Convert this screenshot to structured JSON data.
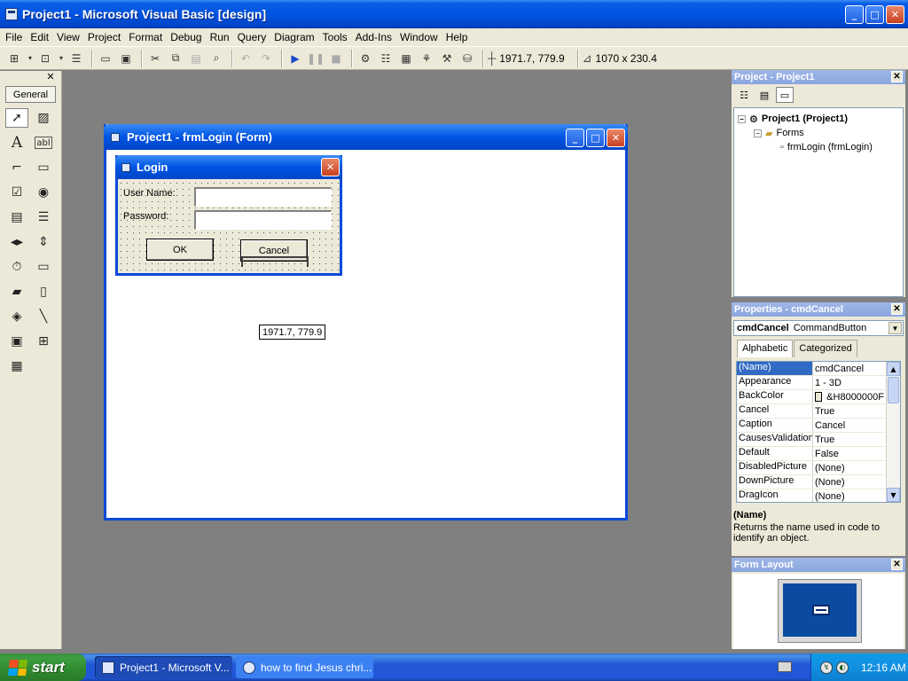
{
  "window": {
    "title": "Project1 - Microsoft Visual Basic [design]",
    "min": "_",
    "max": "□",
    "close": "✕"
  },
  "menu": [
    "File",
    "Edit",
    "View",
    "Project",
    "Format",
    "Debug",
    "Run",
    "Query",
    "Diagram",
    "Tools",
    "Add-Ins",
    "Window",
    "Help"
  ],
  "toolbar": {
    "position": "1971.7, 779.9",
    "size": "1070 x 230.4"
  },
  "toolbox": {
    "tab": "General",
    "close": "✕"
  },
  "designer": {
    "title": "Project1 - frmLogin (Form)",
    "login": {
      "title": "Login",
      "username_label": "User Name:",
      "password_label": "Password:",
      "ok": "OK",
      "cancel": "Cancel"
    },
    "coord_tip": "1971.7, 779.9"
  },
  "project": {
    "title": "Project - Project1",
    "tree": [
      "Project1 (Project1)",
      "Forms",
      "frmLogin (frmLogin)"
    ]
  },
  "properties": {
    "title": "Properties - cmdCancel",
    "object_name": "cmdCancel",
    "object_type": "CommandButton",
    "tabs": [
      "Alphabetic",
      "Categorized"
    ],
    "rows": [
      [
        "(Name)",
        "cmdCancel"
      ],
      [
        "Appearance",
        "1 - 3D"
      ],
      [
        "BackColor",
        "&H8000000F"
      ],
      [
        "Cancel",
        "True"
      ],
      [
        "Caption",
        "Cancel"
      ],
      [
        "CausesValidation",
        "True"
      ],
      [
        "Default",
        "False"
      ],
      [
        "DisabledPicture",
        "(None)"
      ],
      [
        "DownPicture",
        "(None)"
      ],
      [
        "DragIcon",
        "(None)"
      ]
    ],
    "desc_name": "(Name)",
    "desc_text": "Returns the name used in code to identify an object."
  },
  "form_layout": {
    "title": "Form Layout"
  },
  "taskbar": {
    "start": "start",
    "tasks": [
      "Project1 - Microsoft V...",
      "how to find Jesus chri..."
    ],
    "clock": "12:16 AM"
  },
  "colors": {
    "xp_blue": "#0054e3",
    "face": "#ece9d8",
    "workspace": "#808080",
    "selection": "#316ac5"
  }
}
